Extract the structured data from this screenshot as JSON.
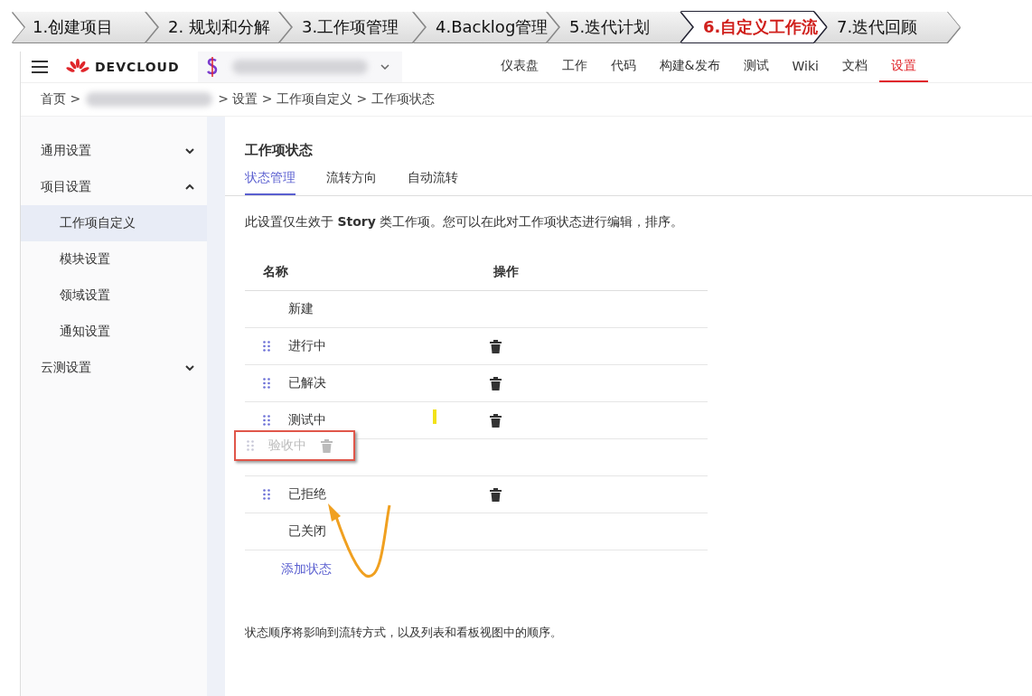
{
  "steps": [
    {
      "label": "1.创建项目",
      "selected": false
    },
    {
      "label": "2. 规划和分解",
      "selected": false
    },
    {
      "label": "3.工作项管理",
      "selected": false
    },
    {
      "label": "4.Backlog管理",
      "selected": false
    },
    {
      "label": "5.迭代计划",
      "selected": false
    },
    {
      "label": "6.自定义工作流",
      "selected": true
    },
    {
      "label": "7.迭代回顾",
      "selected": false
    }
  ],
  "header": {
    "logo": "DEVCLOUD",
    "nav": [
      {
        "label": "仪表盘",
        "selected": false
      },
      {
        "label": "工作",
        "selected": false
      },
      {
        "label": "代码",
        "selected": false
      },
      {
        "label": "构建&发布",
        "selected": false
      },
      {
        "label": "测试",
        "selected": false
      },
      {
        "label": "Wiki",
        "selected": false
      },
      {
        "label": "文档",
        "selected": false
      },
      {
        "label": "设置",
        "selected": true
      }
    ]
  },
  "breadcrumb": {
    "home": "首页 >",
    "rest": "> 设置 > 工作项自定义 > 工作项状态"
  },
  "sidebar": [
    {
      "label": "通用设置",
      "expanded": false
    },
    {
      "label": "项目设置",
      "expanded": true,
      "children": [
        {
          "label": "工作项自定义",
          "selected": true
        },
        {
          "label": "模块设置",
          "selected": false
        },
        {
          "label": "领域设置",
          "selected": false
        },
        {
          "label": "通知设置",
          "selected": false
        }
      ]
    },
    {
      "label": "云测设置",
      "expanded": false
    }
  ],
  "content": {
    "title": "工作项状态",
    "tabs": [
      {
        "label": "状态管理",
        "selected": true
      },
      {
        "label": "流转方向",
        "selected": false
      },
      {
        "label": "自动流转",
        "selected": false
      }
    ],
    "description": "此设置仅生效于 **Story** 类工作项。您可以在此对工作项状态进行编辑，排序。",
    "columns": [
      "名称",
      "操作"
    ],
    "rows": [
      {
        "kind": "status",
        "name": "新建",
        "draggable": false,
        "deletable": false
      },
      {
        "kind": "status",
        "name": "进行中",
        "draggable": true,
        "deletable": true
      },
      {
        "kind": "status",
        "name": "已解决",
        "draggable": true,
        "deletable": true
      },
      {
        "kind": "status",
        "name": "测试中",
        "draggable": true,
        "deletable": true
      },
      {
        "kind": "dragging",
        "name": "验收中",
        "draggable": true,
        "deletable": true
      },
      {
        "kind": "status",
        "name": "已拒绝",
        "draggable": true,
        "deletable": true
      },
      {
        "kind": "status",
        "name": "已关闭",
        "draggable": false,
        "deletable": false
      }
    ],
    "add_link": "添加状态",
    "note": "状态顺序将影响到流转方式，以及列表和看板视图中的顺序。"
  }
}
